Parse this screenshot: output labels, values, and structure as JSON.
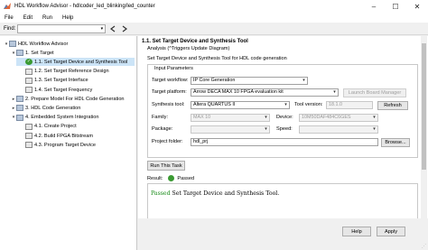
{
  "window": {
    "title": "HDL Workflow Advisor - hdlcoder_led_blinking/led_counter"
  },
  "menu": [
    "File",
    "Edit",
    "Run",
    "Help"
  ],
  "find": {
    "label": "Find:",
    "value": ""
  },
  "tree": {
    "items": [
      {
        "label": "HDL Workflow Advisor",
        "level": 0,
        "expand": "▾",
        "icon": "folder"
      },
      {
        "label": "1. Set Target",
        "level": 1,
        "expand": "▾",
        "icon": "folder"
      },
      {
        "label": "1.1. Set Target Device and Synthesis Tool",
        "level": 2,
        "expand": "",
        "icon": "check",
        "selected": true
      },
      {
        "label": "1.2. Set Target Reference Design",
        "level": 2,
        "expand": "",
        "icon": "task"
      },
      {
        "label": "1.3. Set Target Interface",
        "level": 2,
        "expand": "",
        "icon": "task"
      },
      {
        "label": "1.4. Set Target Frequency",
        "level": 2,
        "expand": "",
        "icon": "task"
      },
      {
        "label": "2. Prepare Model For HDL Code Generation",
        "level": 1,
        "expand": "▸",
        "icon": "folder"
      },
      {
        "label": "3. HDL Code Generation",
        "level": 1,
        "expand": "▸",
        "icon": "folder"
      },
      {
        "label": "4. Embedded System Integration",
        "level": 1,
        "expand": "▾",
        "icon": "folder"
      },
      {
        "label": "4.1. Create Project",
        "level": 2,
        "expand": "",
        "icon": "task"
      },
      {
        "label": "4.2. Build FPGA Bitstream",
        "level": 2,
        "expand": "",
        "icon": "task"
      },
      {
        "label": "4.3. Program Target Device",
        "level": 2,
        "expand": "",
        "icon": "task"
      }
    ]
  },
  "main": {
    "header": "1.1. Set Target Device and Synthesis Tool",
    "analysis": "Analysis (^Triggers Update Diagram)",
    "description": "Set Target Device and Synthesis Tool for HDL code generation",
    "group_title": "Input Parameters",
    "target_workflow": {
      "label": "Target workflow:",
      "value": "IP Core Generation"
    },
    "target_platform": {
      "label": "Target platform:",
      "value": "Arrow DECA MAX 10 FPGA evaluation kit"
    },
    "launch_board_manager": "Launch Board Manager",
    "synthesis_tool": {
      "label": "Synthesis tool:",
      "value": "Altera QUARTUS II"
    },
    "tool_version": {
      "label": "Tool version:",
      "value": "18.1.0"
    },
    "refresh": "Refresh",
    "family": {
      "label": "Family:",
      "value": "MAX 10"
    },
    "device": {
      "label": "Device:",
      "value": "10M50DAF484C6GES"
    },
    "package": {
      "label": "Package:",
      "value": ""
    },
    "speed": {
      "label": "Speed:",
      "value": ""
    },
    "project_folder": {
      "label": "Project folder:",
      "value": "hdl_prj"
    },
    "browse": "Browse...",
    "run_this_task": "Run This Task",
    "result_label": "Result:",
    "result_status": "Passed",
    "result_text_passed": "Passed",
    "result_text_rest": " Set Target Device and Synthesis Tool."
  },
  "buttons": {
    "help": "Help",
    "apply": "Apply"
  },
  "colors": {
    "passed_green": "#1a8c1a",
    "selection": "#cce4f7"
  }
}
